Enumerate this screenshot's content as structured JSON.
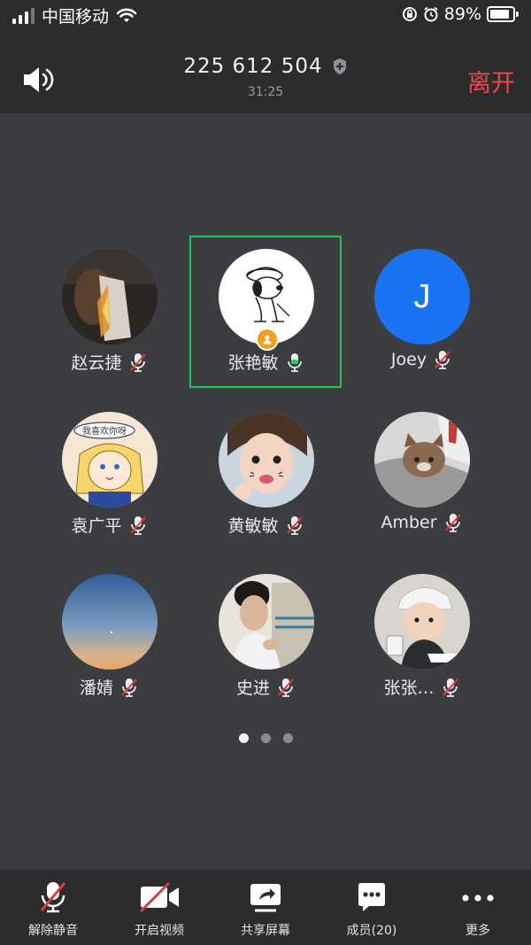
{
  "status_bar": {
    "carrier": "中国移动",
    "battery_percent": "89%",
    "battery_level": 0.89
  },
  "header": {
    "meeting_id": "225 612 504",
    "timer": "31:25",
    "leave_label": "离开"
  },
  "participants": [
    {
      "name": "赵云捷",
      "mic": "muted",
      "avatar": "photo-dark-paper"
    },
    {
      "name": "张艳敏",
      "mic": "on",
      "avatar": "snoopy-drawing",
      "active": true,
      "host": true
    },
    {
      "name": "Joey",
      "mic": "muted",
      "avatar": "letter",
      "initial": "J",
      "color": "#1a73f0"
    },
    {
      "name": "袁广平",
      "mic": "muted",
      "avatar": "cartoon-girl",
      "bubble_text": "我喜欢你呀"
    },
    {
      "name": "黄敏敏",
      "mic": "muted",
      "avatar": "photo-child"
    },
    {
      "name": "Amber",
      "mic": "muted",
      "avatar": "photo-cat"
    },
    {
      "name": "潘婧",
      "mic": "muted",
      "avatar": "photo-sky"
    },
    {
      "name": "史进",
      "mic": "muted",
      "avatar": "photo-man"
    },
    {
      "name": "张张…",
      "mic": "muted",
      "avatar": "photo-baby"
    }
  ],
  "pagination": {
    "pages": 3,
    "current": 1
  },
  "toolbar": {
    "unmute": "解除静音",
    "start_video": "开启视频",
    "share_screen": "共享屏幕",
    "members": "成员(20)",
    "more": "更多"
  },
  "colors": {
    "background": "#3b3d40",
    "bar": "#2b2c2e",
    "leave": "#ec4a4a",
    "active_border": "#22c35a",
    "mute_red": "#e03c3c"
  }
}
